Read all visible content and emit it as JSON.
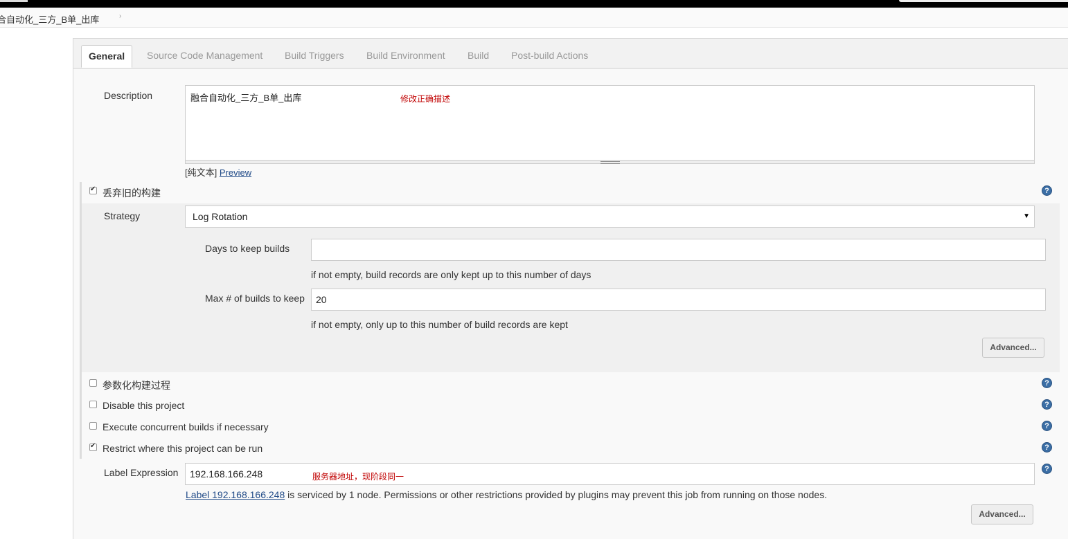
{
  "breadcrumb": {
    "job_name": "合自动化_三方_B单_出库",
    "separator": "›"
  },
  "tabs": [
    {
      "label": "General",
      "active": true
    },
    {
      "label": "Source Code Management"
    },
    {
      "label": "Build Triggers"
    },
    {
      "label": "Build Environment"
    },
    {
      "label": "Build"
    },
    {
      "label": "Post-build Actions"
    }
  ],
  "description": {
    "label": "Description",
    "value": "融合自动化_三方_B单_出库",
    "note": "修改正确描述",
    "format_label": "[纯文本]",
    "preview_link": "Preview"
  },
  "discard_old_builds": {
    "label": "丢弃旧的构建",
    "checked": true,
    "strategy_label": "Strategy",
    "strategy_value": "Log Rotation",
    "days_label": "Days to keep builds",
    "days_value": "",
    "days_hint": "if not empty, build records are only kept up to this number of days",
    "max_label": "Max # of builds to keep",
    "max_value": "20",
    "max_hint": "if not empty, only up to this number of build records are kept",
    "advanced_button": "Advanced..."
  },
  "options": [
    {
      "label": "参数化构建过程",
      "checked": false
    },
    {
      "label": "Disable this project",
      "checked": false
    },
    {
      "label": "Execute concurrent builds if necessary",
      "checked": false
    },
    {
      "label": "Restrict where this project can be run",
      "checked": true
    }
  ],
  "label_expression": {
    "label": "Label Expression",
    "value": "192.168.166.248",
    "note": "服务器地址，现阶段同一",
    "info_link": "Label 192.168.166.248",
    "info_text": " is serviced by 1 node. Permissions or other restrictions provided by plugins may prevent this job from running on those nodes.",
    "advanced_button": "Advanced..."
  },
  "icons": {
    "help": "?",
    "select_arrow": "▼",
    "checkmark": "✔"
  },
  "colors": {
    "note_red": "#c00000",
    "help_blue": "#3b6ea5",
    "link_blue": "#204a87"
  }
}
